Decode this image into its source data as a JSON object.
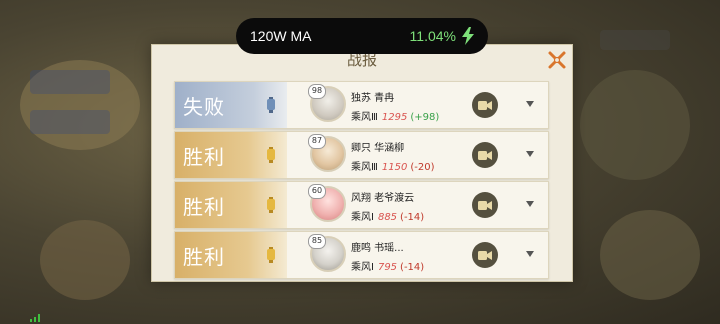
{
  "status_bar": {
    "charger_label": "120W MA",
    "battery_percent": "11.04%",
    "accent_color": "#7ee07a"
  },
  "dialog": {
    "title": "战报",
    "close_icon": "close-x-icon"
  },
  "battles": [
    {
      "result": "失败",
      "result_type": "lose",
      "level": "98",
      "player_name": "独苏 青冉",
      "rank": "乘风Ⅲ",
      "score": "1295",
      "delta": "(+98)"
    },
    {
      "result": "胜利",
      "result_type": "win",
      "level": "87",
      "player_name": "卿只 华涵柳",
      "rank": "乘风Ⅲ",
      "score": "1150",
      "delta": "(-20)"
    },
    {
      "result": "胜利",
      "result_type": "win",
      "level": "60",
      "player_name": "风翔 老爷渡云",
      "rank": "乘风Ⅰ",
      "score": "885",
      "delta": "(-14)"
    },
    {
      "result": "胜利",
      "result_type": "win",
      "level": "85",
      "player_name": "鹿鸣 书瑶...",
      "rank": "乘风Ⅰ",
      "score": "795",
      "delta": "(-14)"
    }
  ],
  "colors": {
    "lose": "#9fb0c9",
    "win": "#d8b068",
    "delta_positive": "#3aa14a",
    "delta_negative": "#c0392b"
  }
}
